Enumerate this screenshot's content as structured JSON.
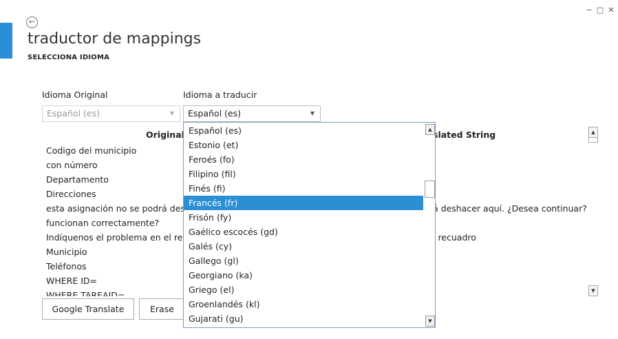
{
  "window": {
    "minimize_label": "−",
    "maximize_label": "□",
    "close_label": "✕"
  },
  "header": {
    "back_glyph": "←",
    "title": "traductor de mappings",
    "subtitle": "SELECCIONA IDIOMA"
  },
  "form": {
    "original_label": "Idioma Original",
    "original_value": "Español (es)",
    "target_label": "Idioma a traducir",
    "target_value": "Español (es)",
    "arrow_glyph": "▼"
  },
  "table": {
    "col_original": "Original",
    "col_translated": "slated String",
    "rows": [
      {
        "original": "Codigo del municipio",
        "translated": ""
      },
      {
        "original": "con número",
        "translated": ""
      },
      {
        "original": "Departamento",
        "translated": ""
      },
      {
        "original": "Direcciones",
        "translated": ""
      },
      {
        "original": "esta asignación no se podrá desh",
        "translated": "á deshacer aquí. ¿Desea continuar?"
      },
      {
        "original": "funcionan correctamente?",
        "translated": ""
      },
      {
        "original": "Indíquenos el problema en el recu",
        "translated": "l recuadro"
      },
      {
        "original": "Municipio",
        "translated": ""
      },
      {
        "original": "Teléfonos",
        "translated": ""
      },
      {
        "original": "WHERE ID=",
        "translated": ""
      },
      {
        "original": "WHERE TAREAID=",
        "translated": ""
      }
    ],
    "scroll_up_glyph": "▲",
    "scroll_down_glyph": "▼"
  },
  "buttons": {
    "google_translate": "Google Translate",
    "erase": "Erase da"
  },
  "dropdown": {
    "selected_index": 5,
    "options": [
      "Español (es)",
      "Estonio (et)",
      "Feroés (fo)",
      "Filipino (fil)",
      "Finés (fi)",
      "Francés (fr)",
      "Frisón (fy)",
      "Gaélico escocés (gd)",
      "Galés (cy)",
      "Gallego (gl)",
      "Georgiano (ka)",
      "Griego (el)",
      "Groenlandés (kl)",
      "Gujarati (gu)"
    ],
    "scroll_up_glyph": "▲",
    "scroll_down_glyph": "▼"
  },
  "colors": {
    "accent": "#2b8fd6",
    "selected_bg": "#2b8fd6"
  }
}
